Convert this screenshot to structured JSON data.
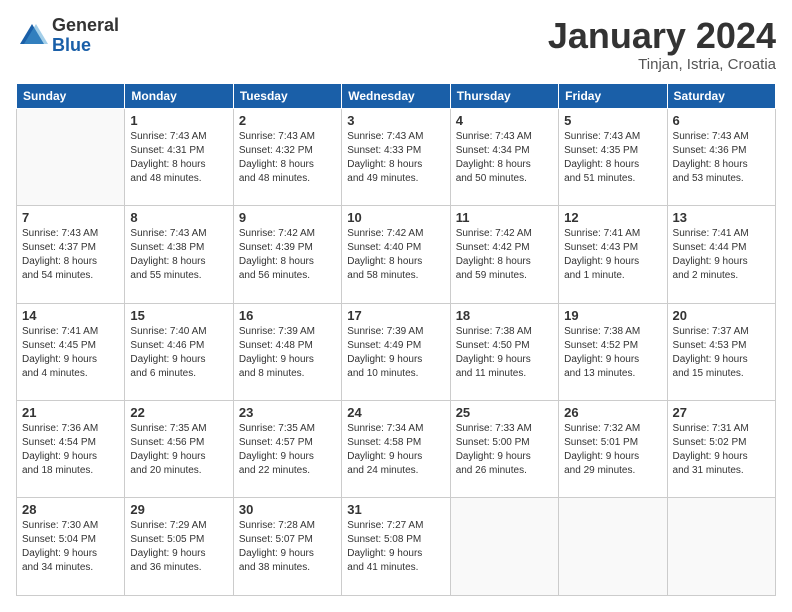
{
  "logo": {
    "general": "General",
    "blue": "Blue"
  },
  "title": "January 2024",
  "location": "Tinjan, Istria, Croatia",
  "days_of_week": [
    "Sunday",
    "Monday",
    "Tuesday",
    "Wednesday",
    "Thursday",
    "Friday",
    "Saturday"
  ],
  "weeks": [
    [
      {
        "day": "",
        "info": ""
      },
      {
        "day": "1",
        "info": "Sunrise: 7:43 AM\nSunset: 4:31 PM\nDaylight: 8 hours\nand 48 minutes."
      },
      {
        "day": "2",
        "info": "Sunrise: 7:43 AM\nSunset: 4:32 PM\nDaylight: 8 hours\nand 48 minutes."
      },
      {
        "day": "3",
        "info": "Sunrise: 7:43 AM\nSunset: 4:33 PM\nDaylight: 8 hours\nand 49 minutes."
      },
      {
        "day": "4",
        "info": "Sunrise: 7:43 AM\nSunset: 4:34 PM\nDaylight: 8 hours\nand 50 minutes."
      },
      {
        "day": "5",
        "info": "Sunrise: 7:43 AM\nSunset: 4:35 PM\nDaylight: 8 hours\nand 51 minutes."
      },
      {
        "day": "6",
        "info": "Sunrise: 7:43 AM\nSunset: 4:36 PM\nDaylight: 8 hours\nand 53 minutes."
      }
    ],
    [
      {
        "day": "7",
        "info": "Sunrise: 7:43 AM\nSunset: 4:37 PM\nDaylight: 8 hours\nand 54 minutes."
      },
      {
        "day": "8",
        "info": "Sunrise: 7:43 AM\nSunset: 4:38 PM\nDaylight: 8 hours\nand 55 minutes."
      },
      {
        "day": "9",
        "info": "Sunrise: 7:42 AM\nSunset: 4:39 PM\nDaylight: 8 hours\nand 56 minutes."
      },
      {
        "day": "10",
        "info": "Sunrise: 7:42 AM\nSunset: 4:40 PM\nDaylight: 8 hours\nand 58 minutes."
      },
      {
        "day": "11",
        "info": "Sunrise: 7:42 AM\nSunset: 4:42 PM\nDaylight: 8 hours\nand 59 minutes."
      },
      {
        "day": "12",
        "info": "Sunrise: 7:41 AM\nSunset: 4:43 PM\nDaylight: 9 hours\nand 1 minute."
      },
      {
        "day": "13",
        "info": "Sunrise: 7:41 AM\nSunset: 4:44 PM\nDaylight: 9 hours\nand 2 minutes."
      }
    ],
    [
      {
        "day": "14",
        "info": "Sunrise: 7:41 AM\nSunset: 4:45 PM\nDaylight: 9 hours\nand 4 minutes."
      },
      {
        "day": "15",
        "info": "Sunrise: 7:40 AM\nSunset: 4:46 PM\nDaylight: 9 hours\nand 6 minutes."
      },
      {
        "day": "16",
        "info": "Sunrise: 7:39 AM\nSunset: 4:48 PM\nDaylight: 9 hours\nand 8 minutes."
      },
      {
        "day": "17",
        "info": "Sunrise: 7:39 AM\nSunset: 4:49 PM\nDaylight: 9 hours\nand 10 minutes."
      },
      {
        "day": "18",
        "info": "Sunrise: 7:38 AM\nSunset: 4:50 PM\nDaylight: 9 hours\nand 11 minutes."
      },
      {
        "day": "19",
        "info": "Sunrise: 7:38 AM\nSunset: 4:52 PM\nDaylight: 9 hours\nand 13 minutes."
      },
      {
        "day": "20",
        "info": "Sunrise: 7:37 AM\nSunset: 4:53 PM\nDaylight: 9 hours\nand 15 minutes."
      }
    ],
    [
      {
        "day": "21",
        "info": "Sunrise: 7:36 AM\nSunset: 4:54 PM\nDaylight: 9 hours\nand 18 minutes."
      },
      {
        "day": "22",
        "info": "Sunrise: 7:35 AM\nSunset: 4:56 PM\nDaylight: 9 hours\nand 20 minutes."
      },
      {
        "day": "23",
        "info": "Sunrise: 7:35 AM\nSunset: 4:57 PM\nDaylight: 9 hours\nand 22 minutes."
      },
      {
        "day": "24",
        "info": "Sunrise: 7:34 AM\nSunset: 4:58 PM\nDaylight: 9 hours\nand 24 minutes."
      },
      {
        "day": "25",
        "info": "Sunrise: 7:33 AM\nSunset: 5:00 PM\nDaylight: 9 hours\nand 26 minutes."
      },
      {
        "day": "26",
        "info": "Sunrise: 7:32 AM\nSunset: 5:01 PM\nDaylight: 9 hours\nand 29 minutes."
      },
      {
        "day": "27",
        "info": "Sunrise: 7:31 AM\nSunset: 5:02 PM\nDaylight: 9 hours\nand 31 minutes."
      }
    ],
    [
      {
        "day": "28",
        "info": "Sunrise: 7:30 AM\nSunset: 5:04 PM\nDaylight: 9 hours\nand 34 minutes."
      },
      {
        "day": "29",
        "info": "Sunrise: 7:29 AM\nSunset: 5:05 PM\nDaylight: 9 hours\nand 36 minutes."
      },
      {
        "day": "30",
        "info": "Sunrise: 7:28 AM\nSunset: 5:07 PM\nDaylight: 9 hours\nand 38 minutes."
      },
      {
        "day": "31",
        "info": "Sunrise: 7:27 AM\nSunset: 5:08 PM\nDaylight: 9 hours\nand 41 minutes."
      },
      {
        "day": "",
        "info": ""
      },
      {
        "day": "",
        "info": ""
      },
      {
        "day": "",
        "info": ""
      }
    ]
  ]
}
